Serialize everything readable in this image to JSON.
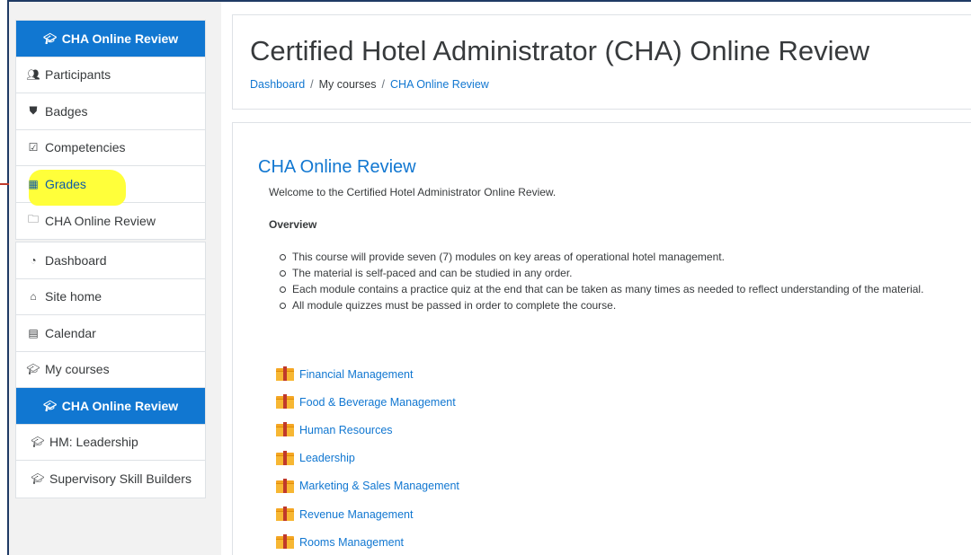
{
  "sidebar": {
    "course_menu": [
      {
        "label": "CHA Online Review",
        "icon": "graduation-cap-icon",
        "active": true
      },
      {
        "label": "Participants",
        "icon": "users-icon"
      },
      {
        "label": "Badges",
        "icon": "shield-icon"
      },
      {
        "label": "Competencies",
        "icon": "check-square-icon"
      },
      {
        "label": "Grades",
        "icon": "table-icon",
        "highlighted": true
      },
      {
        "label": "CHA Online Review",
        "icon": "folder-icon"
      }
    ],
    "site_menu": [
      {
        "label": "Dashboard",
        "icon": "tachometer-icon"
      },
      {
        "label": "Site home",
        "icon": "home-icon"
      },
      {
        "label": "Calendar",
        "icon": "calendar-icon"
      },
      {
        "label": "My courses",
        "icon": "graduation-cap-icon"
      },
      {
        "label": "CHA Online Review",
        "icon": "graduation-cap-icon",
        "active": true
      },
      {
        "label": "HM: Leadership",
        "icon": "graduation-cap-icon"
      },
      {
        "label": "Supervisory Skill Builders",
        "icon": "graduation-cap-icon"
      }
    ]
  },
  "header": {
    "title": "Certified Hotel Administrator (CHA) Online Review",
    "breadcrumb": [
      "Dashboard",
      "My courses",
      "CHA Online Review"
    ],
    "breadcrumb_sep": "/"
  },
  "main": {
    "course_title": "CHA Online Review",
    "welcome": "Welcome to the Certified Hotel Administrator Online Review.",
    "overview_label": "Overview",
    "bullets": [
      "This course will provide seven (7) modules on key areas of operational hotel management.",
      "The material is self-paced and can be studied in any order.",
      "Each module contains a practice quiz at the end that can be taken as many times as needed to reflect understanding of the material.",
      "All module quizzes must be passed in order to complete the course."
    ],
    "modules": [
      "Financial Management",
      "Food & Beverage Management",
      "Human Resources",
      "Leadership",
      "Marketing & Sales Management",
      "Revenue Management",
      "Rooms Management"
    ]
  },
  "colors": {
    "accent": "#1177d1",
    "highlight": "#ffff3a",
    "module_icon": "#f5a623"
  }
}
